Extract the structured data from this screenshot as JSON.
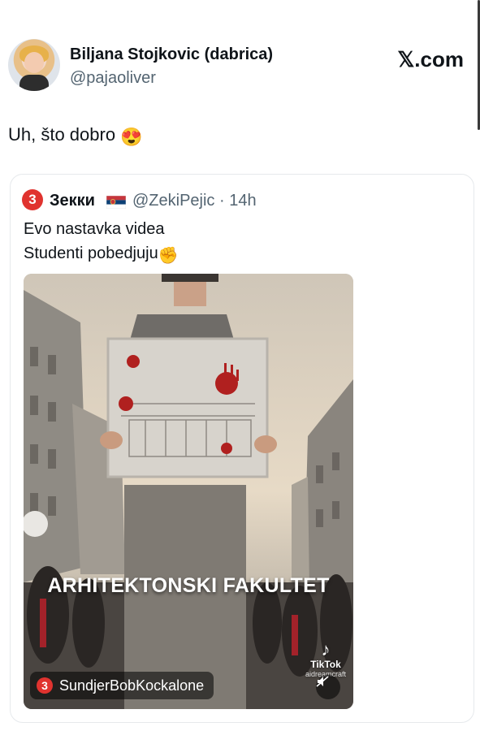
{
  "tweet": {
    "author_name": "Biljana Stojkovic (dabrica)",
    "author_handle": "@pajaoliver",
    "brand": "𝕏.com",
    "text": "Uh, što dobro",
    "emoji": "😍"
  },
  "quoted": {
    "avatar_glyph": "3",
    "author_name": "Зекки",
    "author_handle": "@ZekiPejic · 14h",
    "line1": "Evo nastavka videa",
    "line2": "Studenti pobedjuju",
    "line2_emoji": "✊",
    "media": {
      "caption": "ARHITEKTONSKI FAKULTET",
      "source_label": "SundjerBobKockalone",
      "source_icon": "3",
      "watermark_brand": "TikTok",
      "watermark_user": "aidreamcraft",
      "icons": [
        "tiktok-logo-icon",
        "mute-icon"
      ]
    }
  },
  "colors": {
    "text_primary": "#0f1419",
    "text_secondary": "#536471",
    "card_border": "#e6e9ec",
    "accent_red": "#e0332f"
  }
}
